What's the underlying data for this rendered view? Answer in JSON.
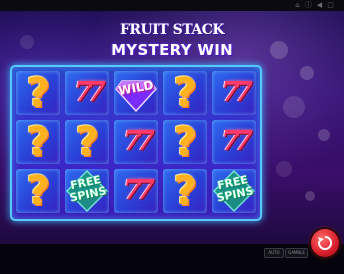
{
  "topbar": {
    "icons": [
      "home-icon",
      "info-icon",
      "sound-icon",
      "fullscreen-icon"
    ]
  },
  "game": {
    "title_line1": "FRUIT STACK",
    "title_line2": "MYSTERY WIN"
  },
  "reels": {
    "columns": 5,
    "rows": 3,
    "grid": [
      [
        "mystery",
        "seven",
        "wild",
        "mystery",
        "seven"
      ],
      [
        "mystery",
        "mystery",
        "seven",
        "mystery",
        "seven"
      ],
      [
        "mystery",
        "free-spins",
        "seven",
        "mystery",
        "free-spins"
      ]
    ],
    "symbol_text": {
      "mystery": "?",
      "seven": "77",
      "wild": "WILD",
      "free-spins": "FREE SPINS"
    }
  },
  "controls": {
    "auto_label": "AUTO",
    "gamble_label": "GAMBLE",
    "spin_icon": "spin-icon"
  },
  "colors": {
    "frame_glow": "#58c8ff",
    "mystery": "#ffb21c",
    "seven": "#ff3a6a",
    "free_spins": "#23d78a",
    "spin_button": "#d81d2a"
  }
}
